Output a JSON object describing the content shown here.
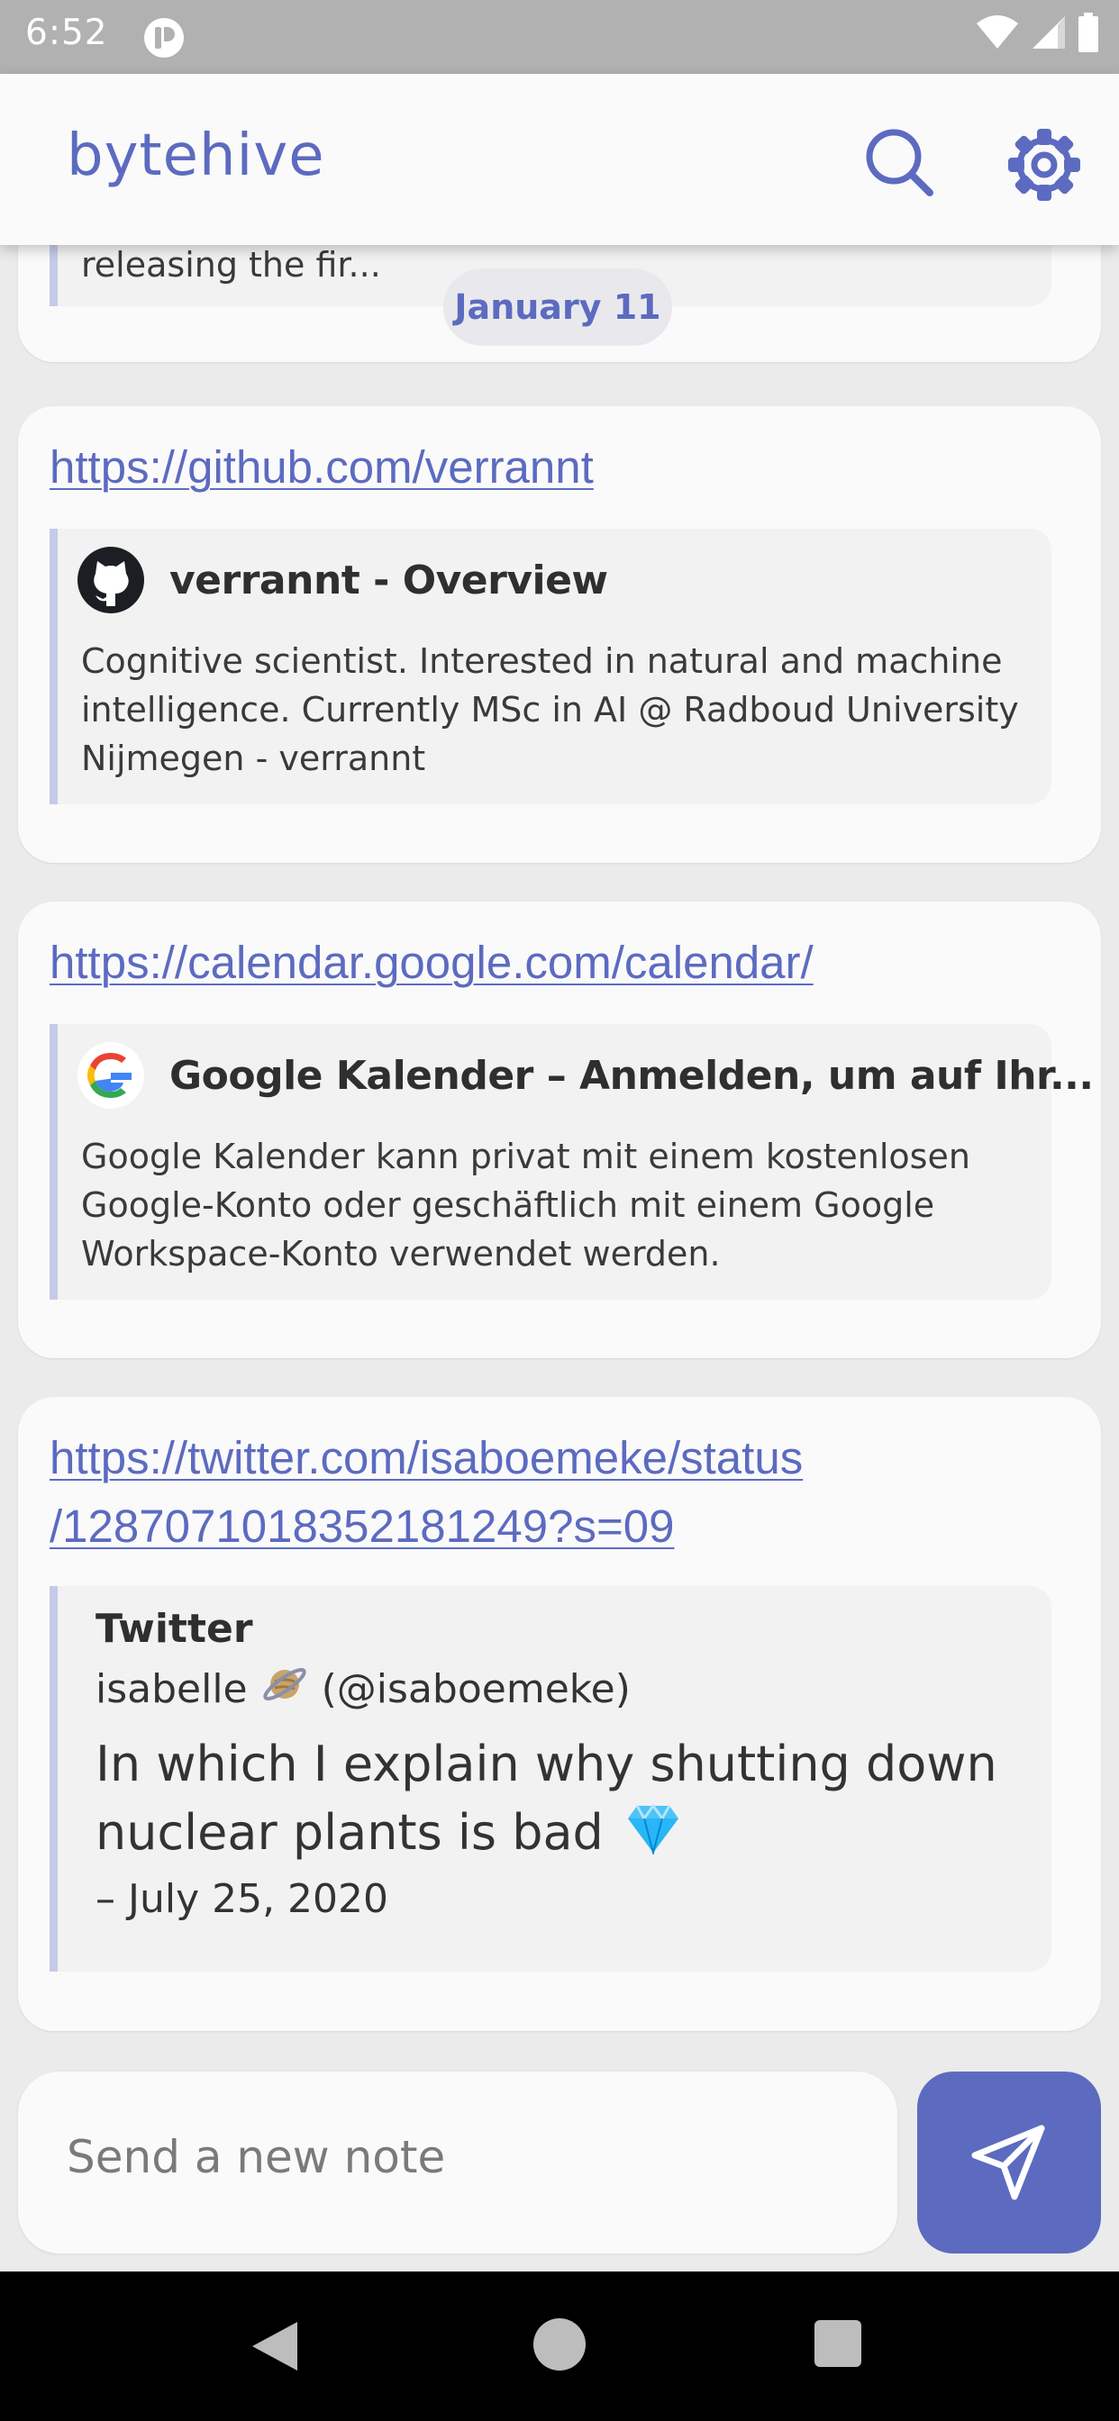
{
  "status_bar": {
    "time": "6:52",
    "app_icon": "notification-app-icon",
    "wifi_icon": "wifi-icon",
    "signal_icon": "cell-signal-icon",
    "battery_icon": "battery-icon"
  },
  "app_bar": {
    "title": "bytehive",
    "search_icon": "search-icon",
    "settings_icon": "gear-icon",
    "accent_color": "#5c6bc0"
  },
  "feed": {
    "partial_note": {
      "preview_text": "releasing the fir...",
      "date_chip": "January 11"
    },
    "notes": [
      {
        "url": "https://github.com/verrannt",
        "preview": {
          "favicon": "github-icon",
          "title": "verrannt - Overview",
          "description": "Cognitive scientist. Interested in natural and machine intelligence. Currently MSc in AI @ Radboud University Nijmegen - verrannt"
        }
      },
      {
        "url": "https://calendar.google.com/calendar/",
        "preview": {
          "favicon": "google-icon",
          "title": "Google Kalender – Anmelden, um auf Ihr...",
          "description": "Google Kalender kann privat mit einem kostenlosen Google-Konto oder geschäftlich mit einem Google Workspace-Konto verwendet werden."
        }
      },
      {
        "url_line1": "https://twitter.com/isaboemeke/status",
        "url_line2": "/1287071018352181249?s=09",
        "preview": {
          "title": "Twitter",
          "author_name": "isabelle",
          "author_emoji": "planet-emoji-icon",
          "author_handle": "(@isaboemeke)",
          "body": "In which I explain why shutting down nuclear plants is bad",
          "body_emoji": "gem-emoji-icon",
          "date": "– July 25, 2020"
        }
      }
    ]
  },
  "composer": {
    "placeholder": "Send a new note",
    "value": "",
    "send_icon": "send-icon"
  },
  "nav_bar": {
    "back_icon": "back-triangle-icon",
    "home_icon": "home-circle-icon",
    "recents_icon": "recents-square-icon"
  }
}
